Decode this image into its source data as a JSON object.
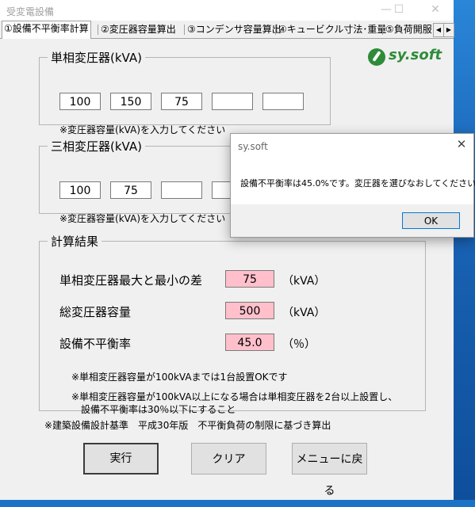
{
  "window": {
    "title": "受変電設備",
    "minimize_glyph": "—",
    "maximize_glyph": "☐",
    "close_glyph": "✕"
  },
  "tabs": [
    "①設備不平衡率計算",
    "②変圧器容量算出",
    "③コンデンサ容量算出",
    "④キュービクル寸法･重量",
    "⑤負荷開服"
  ],
  "tab_scroll": {
    "left": "◀",
    "right": "▶"
  },
  "logo": {
    "text": "sy.soft",
    "color": "#2e8b3a"
  },
  "single_phase": {
    "legend": "単相変圧器(kVA)",
    "values": [
      "100",
      "150",
      "75",
      "",
      ""
    ],
    "note": "※変圧器容量(kVA)を入力してください"
  },
  "three_phase": {
    "legend": "三相変圧器(kVA)",
    "values": [
      "100",
      "75",
      "",
      ""
    ],
    "note": "※変圧器容量(kVA)を入力してください"
  },
  "results": {
    "legend": "計算結果",
    "rows": [
      {
        "label": "単相変圧器最大と最小の差",
        "value": "75",
        "unit": "（kVA）"
      },
      {
        "label": "総変圧器容量",
        "value": "500",
        "unit": "（kVA）"
      },
      {
        "label": "設備不平衡率",
        "value": "45.0",
        "unit": "（％）"
      }
    ],
    "note1": "※単相変圧器容量が100kVAまでは1台設置OKです",
    "note2_line1": "※単相変圧器容量が100kVA以上になる場合は単相変圧器を2台以上設置し、",
    "note2_line2": "設備不平衡率は30％以下にすること"
  },
  "footer_note": "※建築設備設計基準　平成30年版　不平衡負荷の制限に基づき算出",
  "buttons": {
    "run": "実行",
    "clear": "クリア",
    "menu": "メニューに戻る"
  },
  "dialog": {
    "title": "sy.soft",
    "close_glyph": "✕",
    "message": "設備不平衡率は45.0%です。変圧器を選びなおしてください。",
    "ok": "OK"
  },
  "colors": {
    "result_bg": "#ffc0cb",
    "desktop": "#1c72c4",
    "ok_border": "#0078d7"
  }
}
